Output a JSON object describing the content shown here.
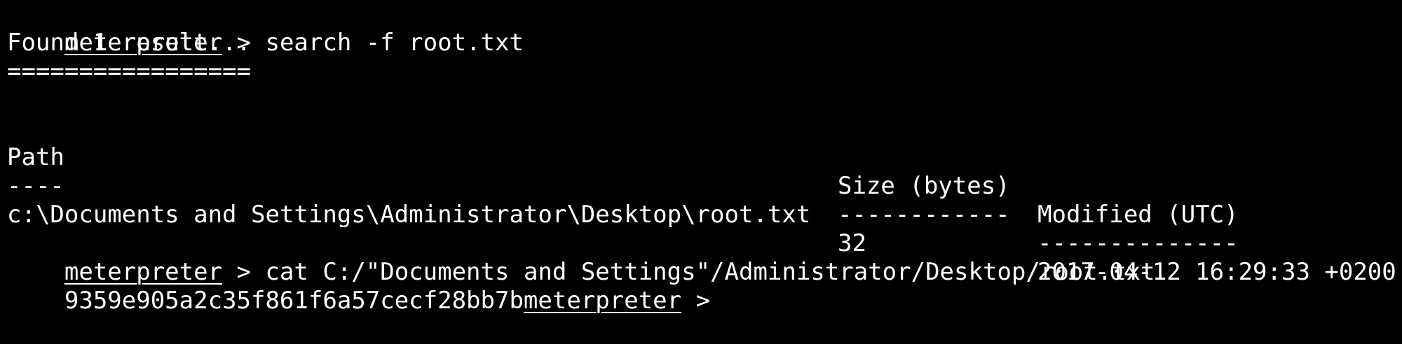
{
  "colors": {
    "background": "#000000",
    "foreground": "#ffffff"
  },
  "session": {
    "prompt": "meterpreter",
    "prompt_sep": " > "
  },
  "commands": {
    "search": "search -f root.txt",
    "cat": "cat C:/\"Documents and Settings\"/Administrator/Desktop/root.txt"
  },
  "search_output": {
    "found": "Found 1 result...",
    "rule": "================="
  },
  "results_table": {
    "headers": {
      "path": "Path",
      "size": "Size (bytes)",
      "modified": "Modified (UTC)"
    },
    "underlines": {
      "path": "----",
      "size": "------------",
      "modified": "--------------"
    },
    "rows": [
      {
        "path": "c:\\Documents and Settings\\Administrator\\Desktop\\root.txt",
        "size": "32",
        "modified": "2017-04-12 16:29:33 +0200"
      }
    ]
  },
  "cat_output": {
    "hash": "9359e905a2c35f861f6a57cecf28bb7b"
  }
}
